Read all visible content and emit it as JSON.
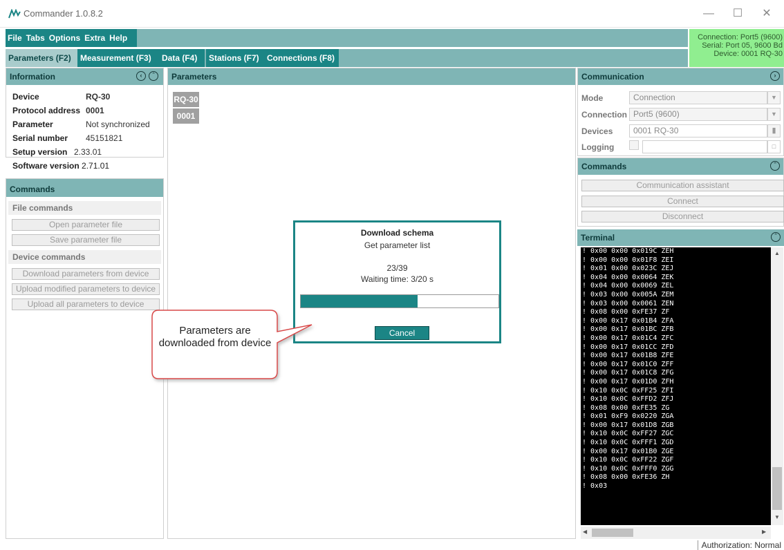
{
  "window": {
    "title": "Commander 1.0.8.2",
    "minimize_label": "—",
    "maximize_label": "☐",
    "close_label": "✕"
  },
  "menu": [
    "File",
    "Tabs",
    "Options",
    "Extra",
    "Help"
  ],
  "tabs": [
    {
      "label": "Parameters (F2)",
      "active": true
    },
    {
      "label": "Measurement (F3)",
      "active": false
    },
    {
      "label": "Data (F4)",
      "active": false
    },
    {
      "label": "Stations (F7)",
      "active": false
    },
    {
      "label": "Connections (F8)",
      "active": false
    }
  ],
  "connection_status": {
    "line1": "Connection: Port5 (9600)",
    "line2": "Serial: Port 05, 9600 Bd",
    "line3": "Device: 0001 RQ-30",
    "color": "#90ee90"
  },
  "information": {
    "title": "Information",
    "rows": [
      {
        "key": "Device",
        "value": "RQ-30",
        "bold": true
      },
      {
        "key": "Protocol address",
        "value": "0001",
        "bold": true
      },
      {
        "key": "Parameter",
        "value": "Not synchronized",
        "bold": false
      },
      {
        "key": "Serial number",
        "value": "45151821",
        "bold": false
      },
      {
        "key": "Setup version",
        "value": "2.33.01",
        "bold": false
      },
      {
        "key": "Software version",
        "value": "2.71.01",
        "bold": false
      }
    ]
  },
  "commands_left": {
    "title": "Commands",
    "file_section": "File commands",
    "open_file": "Open parameter file",
    "save_file": "Save parameter file",
    "device_section": "Device commands",
    "download": "Download parameters from device",
    "upload_modified": "Upload modified parameters to device",
    "upload_all": "Upload all parameters to device"
  },
  "parameters": {
    "title": "Parameters",
    "device_tag": "RQ-30",
    "address_tag": "0001"
  },
  "communication": {
    "title": "Communication",
    "mode_label": "Mode",
    "mode_value": "Connection",
    "connection_label": "Connection",
    "connection_value": "Port5 (9600)",
    "devices_label": "Devices",
    "devices_value": "0001 RQ-30",
    "logging_label": "Logging",
    "logging_value": ""
  },
  "commands_right": {
    "title": "Commands",
    "assistant": "Communication assistant",
    "connect": "Connect",
    "disconnect": "Disconnect"
  },
  "terminal": {
    "title": "Terminal",
    "lines": [
      "! 0x00 0x00 0x019C ZEH",
      "! 0x00 0x00 0x01F8 ZEI",
      "! 0x01 0x00 0x023C ZEJ",
      "! 0x04 0x00 0x0064 ZEK",
      "! 0x04 0x00 0x0069 ZEL",
      "! 0x03 0x00 0x005A ZEM",
      "! 0x03 0x00 0x0061 ZEN",
      "! 0x08 0x00 0xFE37 ZF",
      "! 0x00 0x17 0x01B4 ZFA",
      "! 0x00 0x17 0x01BC ZFB",
      "! 0x00 0x17 0x01C4 ZFC",
      "! 0x00 0x17 0x01CC ZFD",
      "! 0x00 0x17 0x01B8 ZFE",
      "! 0x00 0x17 0x01C0 ZFF",
      "! 0x00 0x17 0x01C8 ZFG",
      "! 0x00 0x17 0x01D0 ZFH",
      "! 0x10 0x0C 0xFF25 ZFI",
      "! 0x10 0x0C 0xFFD2 ZFJ",
      "! 0x08 0x00 0xFE35 ZG",
      "! 0x01 0xF9 0x0220 ZGA",
      "! 0x00 0x17 0x01D8 ZGB",
      "! 0x10 0x0C 0xFF27 ZGC",
      "! 0x10 0x0C 0xFFF1 ZGD",
      "! 0x00 0x17 0x01B0 ZGE",
      "! 0x10 0x0C 0xFF22 ZGF",
      "! 0x10 0x0C 0xFFF0 ZGG",
      "! 0x08 0x00 0xFE36 ZH",
      "! 0x03"
    ]
  },
  "dialog": {
    "title": "Download schema",
    "subtitle": "Get parameter list",
    "count": "23/39",
    "waiting": "Waiting time: 3/20 s",
    "progress_fraction": 0.59,
    "cancel": "Cancel"
  },
  "callout": {
    "text": "Parameters are downloaded from device"
  },
  "status": {
    "authorization": "Authorization: Normal"
  },
  "colors": {
    "accent": "#1b8585",
    "panel_header": "#7fb5b5",
    "active_tab": "#a9cccc",
    "callout_border": "#d94a4a"
  },
  "icons": {
    "app_logo": "commander-logo-icon",
    "collapse_left": "chevron-left-circle-icon",
    "collapse_up": "chevron-up-circle-icon",
    "expand_right": "chevron-right-circle-icon"
  }
}
